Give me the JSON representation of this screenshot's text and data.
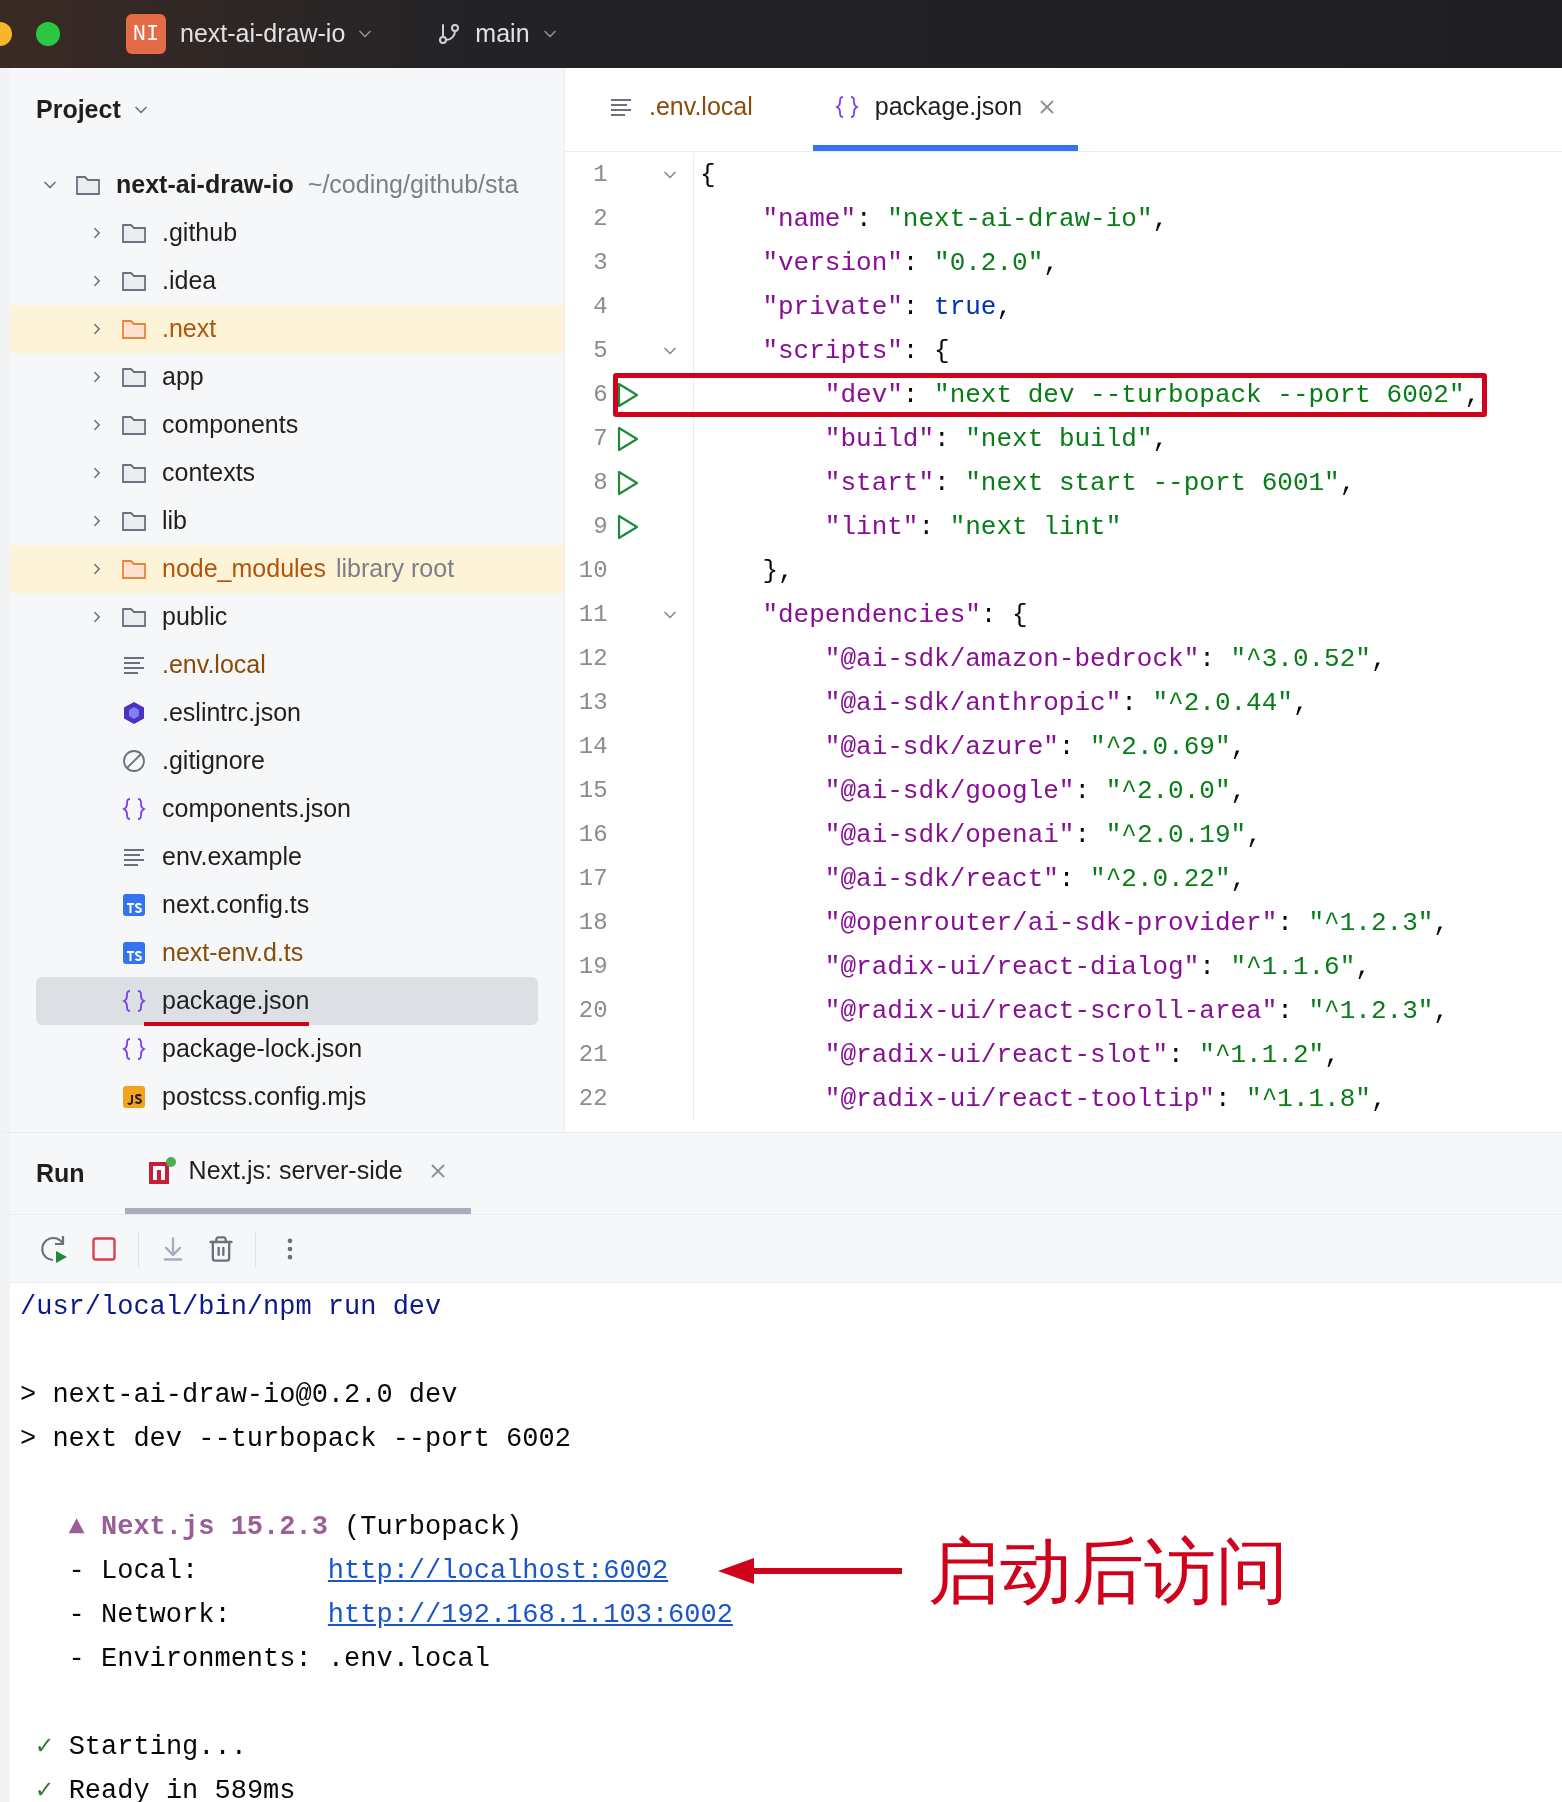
{
  "titlebar": {
    "project_badge": "NI",
    "project": "next-ai-draw-io",
    "branch": "main"
  },
  "project_panel": {
    "title": "Project",
    "root": {
      "name": "next-ai-draw-io",
      "path": "~/coding/github/sta",
      "expanded": true,
      "children": [
        {
          "name": ".github",
          "kind": "folder",
          "excluded": false,
          "ignored": false,
          "expanded": false,
          "selected": false
        },
        {
          "name": ".idea",
          "kind": "folder",
          "excluded": false,
          "ignored": false,
          "expanded": false,
          "selected": false
        },
        {
          "name": ".next",
          "kind": "folder",
          "excluded": true,
          "ignored": false,
          "expanded": false,
          "selected": false
        },
        {
          "name": "app",
          "kind": "folder",
          "excluded": false,
          "ignored": false,
          "expanded": false,
          "selected": false
        },
        {
          "name": "components",
          "kind": "folder",
          "excluded": false,
          "ignored": false,
          "expanded": false,
          "selected": false
        },
        {
          "name": "contexts",
          "kind": "folder",
          "excluded": false,
          "ignored": false,
          "expanded": false,
          "selected": false
        },
        {
          "name": "lib",
          "kind": "folder",
          "excluded": false,
          "ignored": false,
          "expanded": false,
          "selected": false
        },
        {
          "name": "node_modules",
          "note": "library root",
          "kind": "folder",
          "excluded": true,
          "ignored": false,
          "expanded": false,
          "selected": false
        },
        {
          "name": "public",
          "kind": "folder",
          "excluded": false,
          "ignored": false,
          "expanded": false,
          "selected": false
        },
        {
          "name": ".env.local",
          "kind": "text",
          "excluded": false,
          "ignored": true,
          "selected": false
        },
        {
          "name": ".eslintrc.json",
          "kind": "eslint",
          "excluded": false,
          "ignored": false,
          "selected": false
        },
        {
          "name": ".gitignore",
          "kind": "ignore",
          "excluded": false,
          "ignored": false,
          "selected": false
        },
        {
          "name": "components.json",
          "kind": "json",
          "excluded": false,
          "ignored": false,
          "selected": false
        },
        {
          "name": "env.example",
          "kind": "text",
          "excluded": false,
          "ignored": false,
          "selected": false
        },
        {
          "name": "next.config.ts",
          "kind": "ts",
          "excluded": false,
          "ignored": false,
          "selected": false
        },
        {
          "name": "next-env.d.ts",
          "kind": "ts",
          "excluded": false,
          "ignored": true,
          "selected": false
        },
        {
          "name": "package.json",
          "kind": "json",
          "excluded": false,
          "ignored": false,
          "selected": true,
          "underlined": true
        },
        {
          "name": "package-lock.json",
          "kind": "json",
          "excluded": false,
          "ignored": false,
          "selected": false
        },
        {
          "name": "postcss.config.mjs",
          "kind": "js",
          "excluded": false,
          "ignored": false,
          "selected": false
        }
      ]
    }
  },
  "editor_tabs": [
    {
      "label": ".env.local",
      "kind": "text",
      "ignored": true,
      "selected": false,
      "closable": false
    },
    {
      "label": "package.json",
      "kind": "json",
      "ignored": false,
      "selected": true,
      "closable": true
    }
  ],
  "code_lines": [
    {
      "number": "1",
      "foldable": true,
      "runnable": false,
      "highlighted": false,
      "tokens": [
        {
          "kind": "punct",
          "text": "{"
        }
      ]
    },
    {
      "number": "2",
      "foldable": false,
      "runnable": false,
      "highlighted": false,
      "tokens": [
        {
          "kind": "key",
          "text": "    \"name\""
        },
        {
          "kind": "punct",
          "text": ": "
        },
        {
          "kind": "string",
          "text": "\"next-ai-draw-io\""
        },
        {
          "kind": "punct",
          "text": ","
        }
      ]
    },
    {
      "number": "3",
      "foldable": false,
      "runnable": false,
      "highlighted": false,
      "tokens": [
        {
          "kind": "key",
          "text": "    \"version\""
        },
        {
          "kind": "punct",
          "text": ": "
        },
        {
          "kind": "string",
          "text": "\"0.2.0\""
        },
        {
          "kind": "punct",
          "text": ","
        }
      ]
    },
    {
      "number": "4",
      "foldable": false,
      "runnable": false,
      "highlighted": false,
      "tokens": [
        {
          "kind": "key",
          "text": "    \"private\""
        },
        {
          "kind": "punct",
          "text": ": "
        },
        {
          "kind": "keyword",
          "text": "true"
        },
        {
          "kind": "punct",
          "text": ","
        }
      ]
    },
    {
      "number": "5",
      "foldable": true,
      "runnable": false,
      "highlighted": false,
      "tokens": [
        {
          "kind": "key",
          "text": "    \"scripts\""
        },
        {
          "kind": "punct",
          "text": ": {"
        }
      ]
    },
    {
      "number": "6",
      "foldable": false,
      "runnable": true,
      "highlighted": true,
      "tokens": [
        {
          "kind": "key",
          "text": "        \"dev\""
        },
        {
          "kind": "punct",
          "text": ": "
        },
        {
          "kind": "string",
          "text": "\"next dev --turbopack --port 6002\""
        },
        {
          "kind": "punct",
          "text": ","
        }
      ]
    },
    {
      "number": "7",
      "foldable": false,
      "runnable": true,
      "highlighted": false,
      "tokens": [
        {
          "kind": "key",
          "text": "        \"build\""
        },
        {
          "kind": "punct",
          "text": ": "
        },
        {
          "kind": "string",
          "text": "\"next build\""
        },
        {
          "kind": "punct",
          "text": ","
        }
      ]
    },
    {
      "number": "8",
      "foldable": false,
      "runnable": true,
      "highlighted": false,
      "tokens": [
        {
          "kind": "key",
          "text": "        \"start\""
        },
        {
          "kind": "punct",
          "text": ": "
        },
        {
          "kind": "string",
          "text": "\"next start --port 6001\""
        },
        {
          "kind": "punct",
          "text": ","
        }
      ]
    },
    {
      "number": "9",
      "foldable": false,
      "runnable": true,
      "highlighted": false,
      "tokens": [
        {
          "kind": "key",
          "text": "        \"lint\""
        },
        {
          "kind": "punct",
          "text": ": "
        },
        {
          "kind": "string",
          "text": "\"next lint\""
        }
      ]
    },
    {
      "number": "10",
      "foldable": false,
      "runnable": false,
      "highlighted": false,
      "tokens": [
        {
          "kind": "punct",
          "text": "    },"
        }
      ]
    },
    {
      "number": "11",
      "foldable": true,
      "runnable": false,
      "highlighted": false,
      "tokens": [
        {
          "kind": "key",
          "text": "    \"dependencies\""
        },
        {
          "kind": "punct",
          "text": ": {"
        }
      ]
    },
    {
      "number": "12",
      "foldable": false,
      "runnable": false,
      "highlighted": false,
      "tokens": [
        {
          "kind": "key",
          "text": "        \"@ai-sdk/amazon-bedrock\""
        },
        {
          "kind": "punct",
          "text": ": "
        },
        {
          "kind": "string",
          "text": "\"^3.0.52\""
        },
        {
          "kind": "punct",
          "text": ","
        }
      ]
    },
    {
      "number": "13",
      "foldable": false,
      "runnable": false,
      "highlighted": false,
      "tokens": [
        {
          "kind": "key",
          "text": "        \"@ai-sdk/anthropic\""
        },
        {
          "kind": "punct",
          "text": ": "
        },
        {
          "kind": "string",
          "text": "\"^2.0.44\""
        },
        {
          "kind": "punct",
          "text": ","
        }
      ]
    },
    {
      "number": "14",
      "foldable": false,
      "runnable": false,
      "highlighted": false,
      "tokens": [
        {
          "kind": "key",
          "text": "        \"@ai-sdk/azure\""
        },
        {
          "kind": "punct",
          "text": ": "
        },
        {
          "kind": "string",
          "text": "\"^2.0.69\""
        },
        {
          "kind": "punct",
          "text": ","
        }
      ]
    },
    {
      "number": "15",
      "foldable": false,
      "runnable": false,
      "highlighted": false,
      "tokens": [
        {
          "kind": "key",
          "text": "        \"@ai-sdk/google\""
        },
        {
          "kind": "punct",
          "text": ": "
        },
        {
          "kind": "string",
          "text": "\"^2.0.0\""
        },
        {
          "kind": "punct",
          "text": ","
        }
      ]
    },
    {
      "number": "16",
      "foldable": false,
      "runnable": false,
      "highlighted": false,
      "tokens": [
        {
          "kind": "key",
          "text": "        \"@ai-sdk/openai\""
        },
        {
          "kind": "punct",
          "text": ": "
        },
        {
          "kind": "string",
          "text": "\"^2.0.19\""
        },
        {
          "kind": "punct",
          "text": ","
        }
      ]
    },
    {
      "number": "17",
      "foldable": false,
      "runnable": false,
      "highlighted": false,
      "tokens": [
        {
          "kind": "key",
          "text": "        \"@ai-sdk/react\""
        },
        {
          "kind": "punct",
          "text": ": "
        },
        {
          "kind": "string",
          "text": "\"^2.0.22\""
        },
        {
          "kind": "punct",
          "text": ","
        }
      ]
    },
    {
      "number": "18",
      "foldable": false,
      "runnable": false,
      "highlighted": false,
      "tokens": [
        {
          "kind": "key",
          "text": "        \"@openrouter/ai-sdk-provider\""
        },
        {
          "kind": "punct",
          "text": ": "
        },
        {
          "kind": "string",
          "text": "\"^1.2.3\""
        },
        {
          "kind": "punct",
          "text": ","
        }
      ]
    },
    {
      "number": "19",
      "foldable": false,
      "runnable": false,
      "highlighted": false,
      "tokens": [
        {
          "kind": "key",
          "text": "        \"@radix-ui/react-dialog\""
        },
        {
          "kind": "punct",
          "text": ": "
        },
        {
          "kind": "string",
          "text": "\"^1.1.6\""
        },
        {
          "kind": "punct",
          "text": ","
        }
      ]
    },
    {
      "number": "20",
      "foldable": false,
      "runnable": false,
      "highlighted": false,
      "tokens": [
        {
          "kind": "key",
          "text": "        \"@radix-ui/react-scroll-area\""
        },
        {
          "kind": "punct",
          "text": ": "
        },
        {
          "kind": "string",
          "text": "\"^1.2.3\""
        },
        {
          "kind": "punct",
          "text": ","
        }
      ]
    },
    {
      "number": "21",
      "foldable": false,
      "runnable": false,
      "highlighted": false,
      "tokens": [
        {
          "kind": "key",
          "text": "        \"@radix-ui/react-slot\""
        },
        {
          "kind": "punct",
          "text": ": "
        },
        {
          "kind": "string",
          "text": "\"^1.1.2\""
        },
        {
          "kind": "punct",
          "text": ","
        }
      ]
    },
    {
      "number": "22",
      "foldable": false,
      "runnable": false,
      "highlighted": false,
      "tokens": [
        {
          "kind": "key",
          "text": "        \"@radix-ui/react-tooltip\""
        },
        {
          "kind": "punct",
          "text": ": "
        },
        {
          "kind": "string",
          "text": "\"^1.1.8\""
        },
        {
          "kind": "punct",
          "text": ","
        }
      ]
    }
  ],
  "run_panel": {
    "title": "Run",
    "tabs": [
      {
        "label": "Next.js: server-side",
        "selected": true,
        "closable": true
      }
    ],
    "console_lines": [
      {
        "kind": "text",
        "tokens": [
          {
            "kind": "command",
            "text": "/usr/local/bin/npm run dev"
          }
        ]
      },
      {
        "kind": "blank"
      },
      {
        "kind": "text",
        "tokens": [
          {
            "kind": "plain",
            "text": "> next-ai-draw-io@0.2.0 dev"
          }
        ]
      },
      {
        "kind": "text",
        "tokens": [
          {
            "kind": "plain",
            "text": "> next dev --turbopack --port 6002"
          }
        ]
      },
      {
        "kind": "blank"
      },
      {
        "kind": "text",
        "tokens": [
          {
            "kind": "accent",
            "text": "   ▲ Next.js 15.2.3"
          },
          {
            "kind": "plain",
            "text": " (Turbopack)"
          }
        ]
      },
      {
        "kind": "text",
        "tokens": [
          {
            "kind": "plain",
            "text": "   - Local:        "
          },
          {
            "kind": "link",
            "text": "http://localhost:6002"
          }
        ],
        "annotation": "启动后访问"
      },
      {
        "kind": "text",
        "tokens": [
          {
            "kind": "plain",
            "text": "   - Network:      "
          },
          {
            "kind": "link",
            "text": "http://192.168.1.103:6002"
          }
        ]
      },
      {
        "kind": "text",
        "tokens": [
          {
            "kind": "plain",
            "text": "   - Environments: .env.local"
          }
        ]
      },
      {
        "kind": "blank"
      },
      {
        "kind": "text",
        "tokens": [
          {
            "kind": "check",
            "text": " ✓"
          },
          {
            "kind": "plain",
            "text": " Starting..."
          }
        ]
      },
      {
        "kind": "text",
        "tokens": [
          {
            "kind": "check",
            "text": " ✓"
          },
          {
            "kind": "plain",
            "text": " Ready in 589ms"
          }
        ]
      }
    ]
  }
}
